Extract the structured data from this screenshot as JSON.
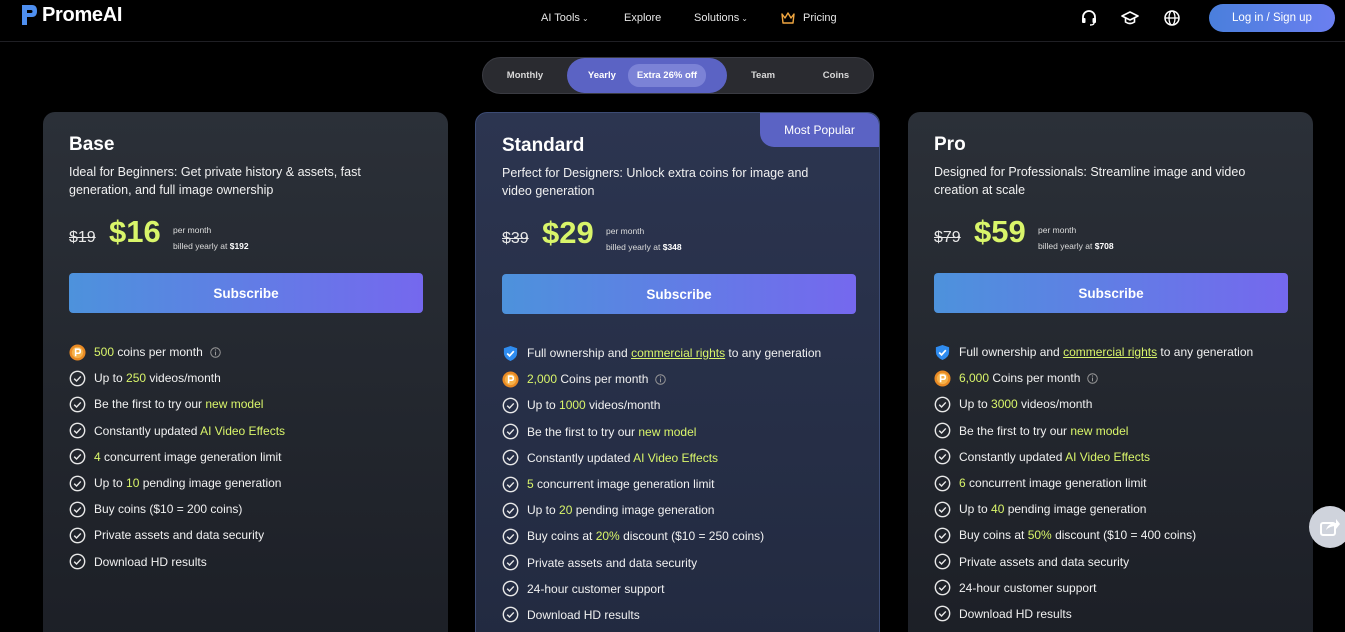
{
  "header": {
    "logo_text": "PromeAI",
    "nav": {
      "ai_tools": "AI Tools",
      "explore": "Explore",
      "solutions": "Solutions",
      "pricing": "Pricing"
    },
    "login_label": "Log in / Sign up"
  },
  "billing_toggle": {
    "monthly": "Monthly",
    "yearly": "Yearly",
    "yearly_badge": "Extra 26% off",
    "team": "Team",
    "coins": "Coins",
    "selected": "Yearly"
  },
  "plans": [
    {
      "name": "Base",
      "description": "Ideal for Beginners: Get private history & assets, fast generation, and full image ownership",
      "old_price": "$19",
      "price": "$16",
      "per_month": "per month",
      "billed_prefix": "billed yearly at",
      "billed_amount": "$192",
      "subscribe": "Subscribe",
      "features": [
        {
          "icon": "coin-icon",
          "pre": "",
          "hl": "500",
          "post": " coins per month",
          "info": true
        },
        {
          "icon": "check-circle-icon",
          "pre": "Up to ",
          "hl": "250",
          "post": " videos/month"
        },
        {
          "icon": "check-circle-icon",
          "pre": "Be the first to try our ",
          "hl": "new model",
          "post": ""
        },
        {
          "icon": "check-circle-icon",
          "pre": "Constantly updated ",
          "hl": "AI Video Effects",
          "post": ""
        },
        {
          "icon": "check-circle-icon",
          "pre": "",
          "hl": "4",
          "post": " concurrent image generation limit"
        },
        {
          "icon": "check-circle-icon",
          "pre": "Up to ",
          "hl": "10",
          "post": " pending image generation"
        },
        {
          "icon": "check-circle-icon",
          "pre": "Buy coins ($10 = 200 coins)",
          "hl": "",
          "post": ""
        },
        {
          "icon": "check-circle-icon",
          "pre": "Private assets and data security",
          "hl": "",
          "post": ""
        },
        {
          "icon": "check-circle-icon",
          "pre": "Download HD results",
          "hl": "",
          "post": ""
        }
      ]
    },
    {
      "name": "Standard",
      "badge": "Most Popular",
      "description": "Perfect for Designers: Unlock extra coins for image and video generation",
      "old_price": "$39",
      "price": "$29",
      "per_month": "per month",
      "billed_prefix": "billed yearly at",
      "billed_amount": "$348",
      "subscribe": "Subscribe",
      "features": [
        {
          "icon": "shield-check-icon",
          "pre": "Full ownership and ",
          "ul": "commercial rights",
          "post": " to any generation"
        },
        {
          "icon": "coin-icon",
          "pre": "",
          "hl": "2,000",
          "post": " Coins per month",
          "info": true
        },
        {
          "icon": "check-circle-icon",
          "pre": "Up to ",
          "hl": "1000",
          "post": " videos/month"
        },
        {
          "icon": "check-circle-icon",
          "pre": "Be the first to try our ",
          "hl": "new model",
          "post": ""
        },
        {
          "icon": "check-circle-icon",
          "pre": "Constantly updated ",
          "hl": "AI Video Effects",
          "post": ""
        },
        {
          "icon": "check-circle-icon",
          "pre": "",
          "hl": "5",
          "post": " concurrent image generation limit"
        },
        {
          "icon": "check-circle-icon",
          "pre": "Up to ",
          "hl": "20",
          "post": " pending image generation"
        },
        {
          "icon": "check-circle-icon",
          "pre": "Buy coins at ",
          "hl": "20%",
          "post": " discount ($10 = 250 coins)"
        },
        {
          "icon": "check-circle-icon",
          "pre": "Private assets and data security",
          "hl": "",
          "post": ""
        },
        {
          "icon": "check-circle-icon",
          "pre": "24-hour customer support",
          "hl": "",
          "post": ""
        },
        {
          "icon": "check-circle-icon",
          "pre": "Download HD results",
          "hl": "",
          "post": ""
        }
      ]
    },
    {
      "name": "Pro",
      "description": "Designed for Professionals: Streamline image and video creation at scale",
      "old_price": "$79",
      "price": "$59",
      "per_month": "per month",
      "billed_prefix": "billed yearly at",
      "billed_amount": "$708",
      "subscribe": "Subscribe",
      "features": [
        {
          "icon": "shield-check-icon",
          "pre": "Full ownership and ",
          "ul": "commercial rights",
          "post": " to any generation"
        },
        {
          "icon": "coin-icon",
          "pre": "",
          "hl": "6,000",
          "post": " Coins per month",
          "info": true
        },
        {
          "icon": "check-circle-icon",
          "pre": "Up to ",
          "hl": "3000",
          "post": " videos/month"
        },
        {
          "icon": "check-circle-icon",
          "pre": "Be the first to try our ",
          "hl": "new model",
          "post": ""
        },
        {
          "icon": "check-circle-icon",
          "pre": "Constantly updated ",
          "hl": "AI Video Effects",
          "post": ""
        },
        {
          "icon": "check-circle-icon",
          "pre": "",
          "hl": "6",
          "post": " concurrent image generation limit"
        },
        {
          "icon": "check-circle-icon",
          "pre": "Up to ",
          "hl": "40",
          "post": " pending image generation"
        },
        {
          "icon": "check-circle-icon",
          "pre": "Buy coins at ",
          "hl": "50%",
          "post": " discount ($10 = 400 coins)"
        },
        {
          "icon": "check-circle-icon",
          "pre": "Private assets and data security",
          "hl": "",
          "post": ""
        },
        {
          "icon": "check-circle-icon",
          "pre": "24-hour customer support",
          "hl": "",
          "post": ""
        },
        {
          "icon": "check-circle-icon",
          "pre": "Download HD results",
          "hl": "",
          "post": ""
        }
      ]
    }
  ],
  "colors": {
    "background": "#000000",
    "accent_green": "#d9f56a",
    "accent_purple": "#5b63c4",
    "subscribe_gradient_start": "#4d92dc",
    "subscribe_gradient_end": "#7568ee"
  }
}
